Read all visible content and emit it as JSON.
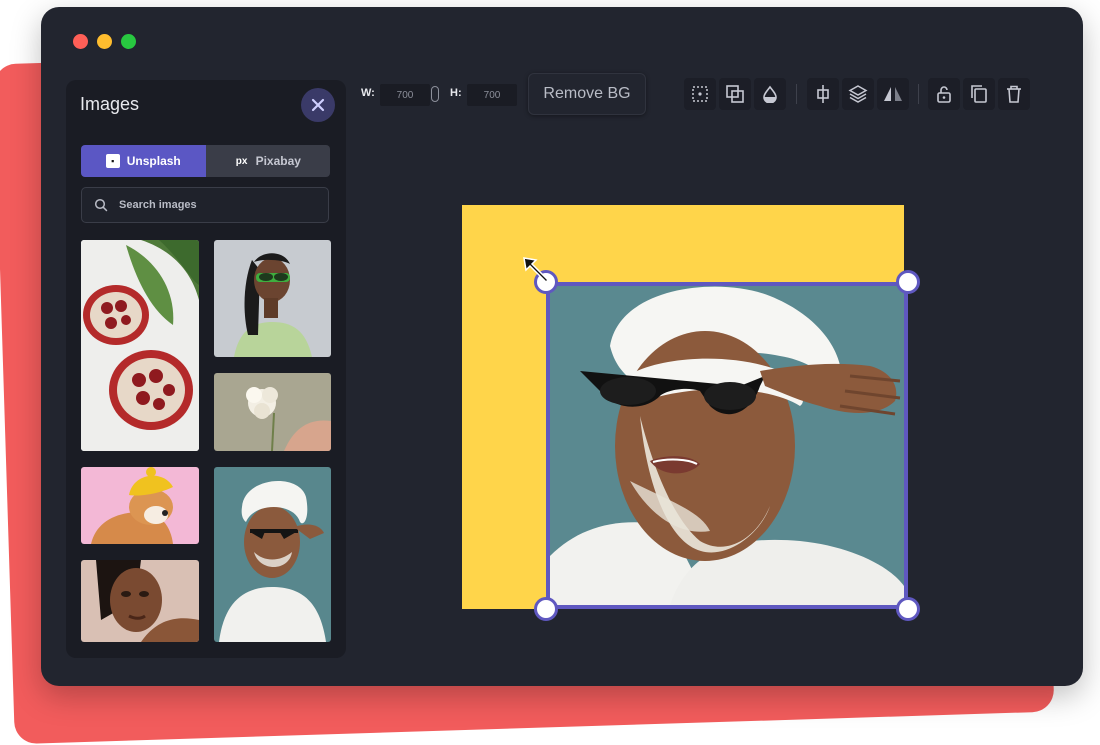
{
  "window": {
    "controls": [
      "close",
      "minimize",
      "zoom"
    ],
    "control_colors": [
      "#ff5f57",
      "#ffbd2e",
      "#28c840"
    ]
  },
  "sidebar": {
    "title": "Images",
    "close_icon": "close-icon",
    "tabs": [
      {
        "label": "Unsplash",
        "icon": "unsplash-icon",
        "active": true
      },
      {
        "label": "Pixabay",
        "icon": "pixabay-icon",
        "active": false
      }
    ],
    "search": {
      "placeholder": "Search images",
      "value": ""
    },
    "images": [
      {
        "subject": "pomegranate"
      },
      {
        "subject": "woman-green-sunglasses"
      },
      {
        "subject": "white-flower"
      },
      {
        "subject": "dog-yellow-hat"
      },
      {
        "subject": "woman-portrait"
      },
      {
        "subject": "woman-face-mask"
      }
    ]
  },
  "toolbar": {
    "width_label": "W:",
    "width_value": "700",
    "height_label": "H:",
    "height_value": "700",
    "remove_bg_label": "Remove BG",
    "tools": [
      "grid-icon",
      "overlap-icon",
      "opacity-icon",
      "align-center-icon",
      "layers-icon",
      "flip-icon",
      "unlock-icon",
      "duplicate-icon",
      "trash-icon"
    ]
  },
  "canvas": {
    "background_color": "#ffd54a",
    "selection_color": "#5f58c0",
    "photo_subject": "woman-face-mask"
  }
}
